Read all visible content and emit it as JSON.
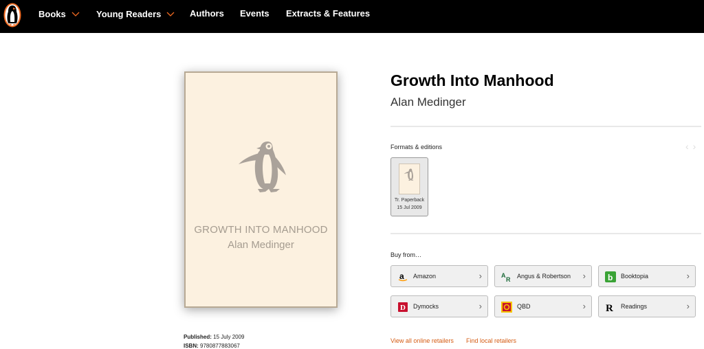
{
  "nav": {
    "items": [
      {
        "label": "Books",
        "dropdown": true
      },
      {
        "label": "Young Readers",
        "dropdown": true
      },
      {
        "label": "Authors",
        "dropdown": false
      },
      {
        "label": "Events",
        "dropdown": false
      },
      {
        "label": "Extracts & Features",
        "dropdown": false
      }
    ]
  },
  "colors": {
    "nav_bg": "#000000",
    "logo": "#f26b21",
    "chevron": "#f26b21",
    "accent_link": "#d55b12",
    "cover_bg": "#fcf1e0"
  },
  "cover": {
    "title": "GROWTH INTO MANHOOD",
    "author": "Alan Medinger"
  },
  "book": {
    "title": "Growth Into Manhood",
    "author": "Alan Medinger",
    "published_label": "Published:",
    "published_value": "15 July 2009",
    "isbn_label": "ISBN:",
    "isbn_value": "9780877883067"
  },
  "formats": {
    "label": "Formats & editions",
    "editions": [
      {
        "format": "Tr. Paperback",
        "date": "15 Jul 2009"
      }
    ]
  },
  "buy": {
    "label": "Buy from…",
    "retailers": [
      {
        "name": "Amazon",
        "icon": "amazon-icon"
      },
      {
        "name": "Angus & Robertson",
        "icon": "angus-robertson-icon"
      },
      {
        "name": "Booktopia",
        "icon": "booktopia-icon"
      },
      {
        "name": "Dymocks",
        "icon": "dymocks-icon"
      },
      {
        "name": "QBD",
        "icon": "qbd-icon"
      },
      {
        "name": "Readings",
        "icon": "readings-icon"
      }
    ],
    "view_all": "View all online retailers",
    "find_local": "Find local retailers"
  }
}
